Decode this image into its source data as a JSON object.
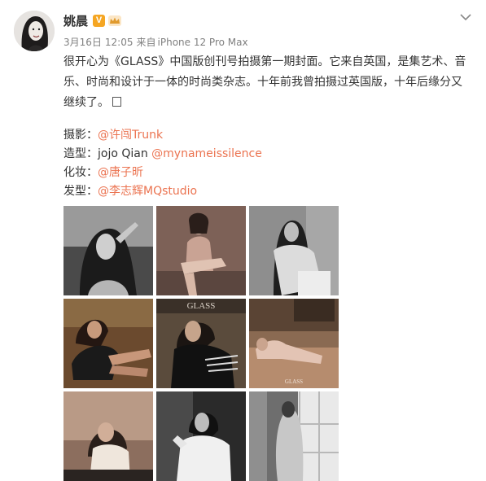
{
  "post": {
    "author": {
      "name": "姚晨",
      "verified_badge": "V",
      "badge_icon": "crown-icon",
      "avatar_icon": "avatar-portrait"
    },
    "meta": {
      "date": "3月16日",
      "time": "12:05",
      "source_prefix": "来自",
      "device": "iPhone 12 Pro Max"
    },
    "menu_icon": "chevron-down-icon",
    "content": {
      "lines": [
        "很开心为《GLASS》中国版创刊号拍摄第一期封面。它来自英国，是集艺术、音",
        "乐、时尚和设计于一体的时尚类杂志。十年前我曾拍摄过英国版，十年后缘分又",
        "继续了。"
      ],
      "emoji_icon": "missing-glyph-box"
    },
    "credits": [
      {
        "label": "摄影：",
        "mention": "@许闯Trunk",
        "person": ""
      },
      {
        "label": "造型：",
        "person": "jojo Qian ",
        "mention": "@mynameissilence"
      },
      {
        "label": "化妆：",
        "mention": "@唐子昕",
        "person": ""
      },
      {
        "label": "发型：",
        "mention": "@李志辉MQstudio",
        "person": ""
      }
    ],
    "photos": {
      "count": 9,
      "captions_visible": [
        "GLASS",
        "GLASS"
      ]
    },
    "colors": {
      "mention": "#eb7350",
      "text": "#333333",
      "meta": "#808080",
      "verified": "#f5a623"
    }
  }
}
